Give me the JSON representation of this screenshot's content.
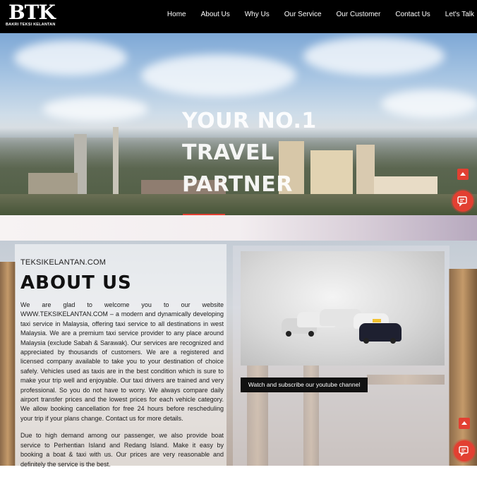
{
  "brand": {
    "logo_mark": "BTK",
    "logo_text": "BAKRI TEKSI KELANTAN"
  },
  "nav": {
    "items": [
      "Home",
      "About Us",
      "Why Us",
      "Our Service",
      "Our Customer",
      "Contact Us",
      "Let's Talk"
    ]
  },
  "hero": {
    "title_lines": [
      "YOUR NO.1",
      "TRAVEL",
      "PARTNER"
    ]
  },
  "about": {
    "site_name": "TEKSIKELANTAN.COM",
    "heading": "ABOUT US",
    "paragraphs": [
      "We are glad to welcome you to our website WWW.TEKSIKELANTAN.COM – a modern and dynamically developing taxi service in Malaysia, offering taxi service to all destinations in west Malaysia. We are a premium taxi service provider to any place around Malaysia (exclude Sabah & Sarawak). Our services are recognized and appreciated by thousands of customers. We are a registered and licensed company available to take you to your destination of choice safely. Vehicles used as taxis are in the best condition which is sure to make your trip well and enjoyable. Our taxi drivers are trained and very professional. So you do not have to worry. We always compare daily airport transfer prices and the lowest prices for each vehicle category. We allow booking cancellation for free 24 hours before rescheduling your trip if your plans change. Contact us for more details.",
      "Due to high demand among our passenger, we also provide boat service to Perhentian Island and Redang Island. Make it easy by booking a boat & taxi with us. Our prices are very reasonable and definitely the service is the best."
    ],
    "youtube_button": "Watch and subscribe our youtube channel"
  },
  "colors": {
    "accent": "#e24032",
    "header_bg": "#000000"
  },
  "icons": [
    "scroll-to-top-icon",
    "chat-bubble-icon"
  ]
}
